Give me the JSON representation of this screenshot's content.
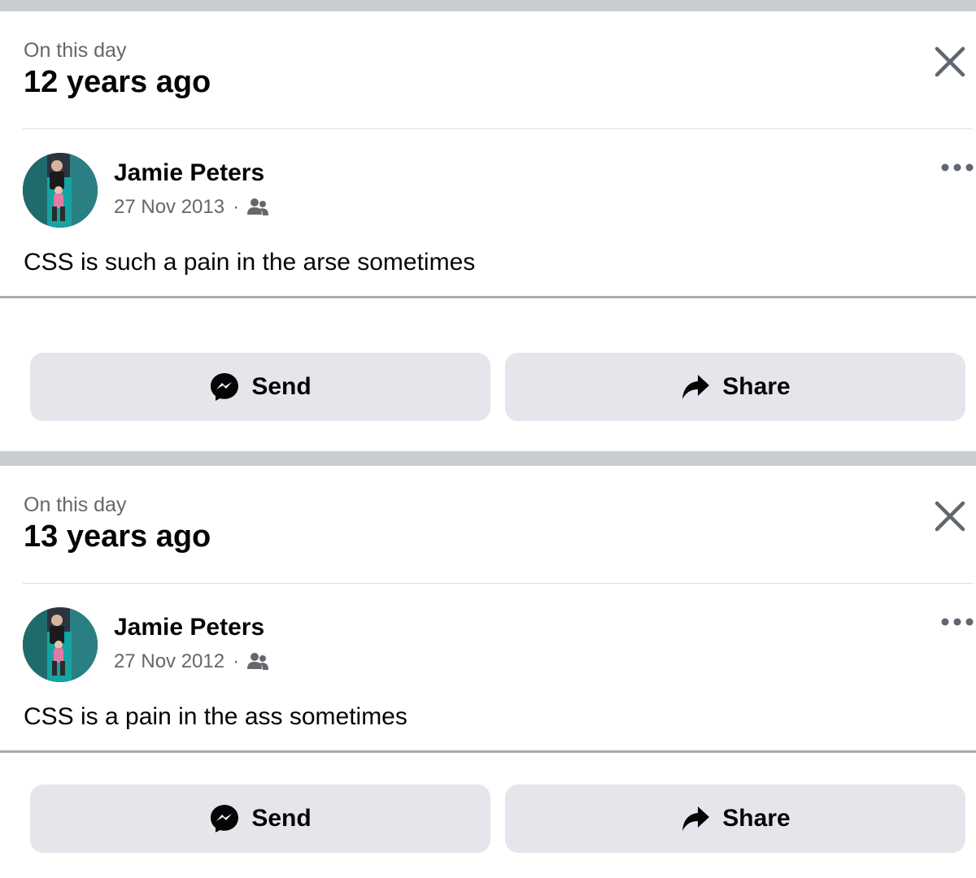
{
  "memories": [
    {
      "label": "On this day",
      "title": "12 years ago",
      "author": "Jamie Peters",
      "date": "27 Nov 2013",
      "separator": "·",
      "post_text": "CSS is such a pain in the arse sometimes",
      "send_label": "Send",
      "share_label": "Share"
    },
    {
      "label": "On this day",
      "title": "13 years ago",
      "author": "Jamie Peters",
      "date": "27 Nov 2012",
      "separator": "·",
      "post_text": "CSS is a pain in the ass sometimes",
      "send_label": "Send",
      "share_label": "Share"
    }
  ],
  "icons": {
    "close": "close-icon",
    "more": "more-options-icon",
    "audience": "friends-icon",
    "send": "messenger-icon",
    "share": "share-arrow-icon"
  },
  "colors": {
    "band": "#c9ccd1",
    "button_bg": "#e4e6eb",
    "secondary_text": "#65676b",
    "primary_text": "#050505"
  }
}
